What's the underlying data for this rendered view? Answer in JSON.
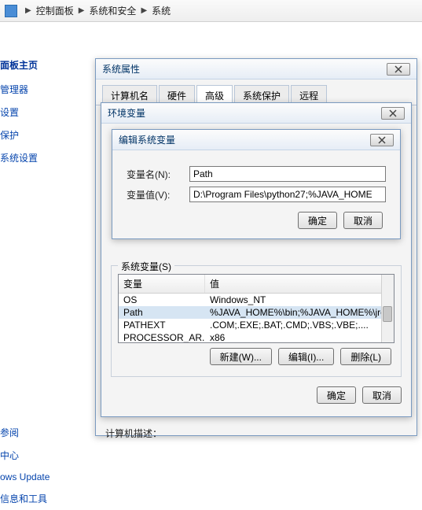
{
  "breadcrumb": {
    "items": [
      "控制面板",
      "系统和安全",
      "系统"
    ]
  },
  "sidebar": {
    "title": "面板主页",
    "links1": [
      "管理器",
      "设置",
      "保护",
      "系统设置"
    ],
    "links2": [
      "参阅",
      "中心",
      "ows Update",
      "信息和工具"
    ]
  },
  "sysprop": {
    "title": "系统属性",
    "tabs": [
      "计算机名",
      "硬件",
      "高级",
      "系统保护",
      "远程"
    ],
    "active_tab": 2,
    "desc": "计算机描述："
  },
  "env": {
    "title": "环境变量",
    "sysvar_label": "系统变量(S)",
    "cols": [
      "变量",
      "值"
    ],
    "rows": [
      {
        "name": "OS",
        "value": "Windows_NT"
      },
      {
        "name": "Path",
        "value": "%JAVA_HOME%\\bin;%JAVA_HOME%\\jre..."
      },
      {
        "name": "PATHEXT",
        "value": ".COM;.EXE;.BAT;.CMD;.VBS;.VBE;...."
      },
      {
        "name": "PROCESSOR_AR...",
        "value": "x86"
      }
    ],
    "btn_new": "新建(W)...",
    "btn_edit": "编辑(I)...",
    "btn_del": "删除(L)",
    "ok": "确定",
    "cancel": "取消"
  },
  "edit": {
    "title": "编辑系统变量",
    "name_label": "变量名(N):",
    "name_value": "Path",
    "val_label": "变量值(V):",
    "val_value": "D:\\Program Files\\python27;%JAVA_HOME",
    "ok": "确定",
    "cancel": "取消"
  }
}
